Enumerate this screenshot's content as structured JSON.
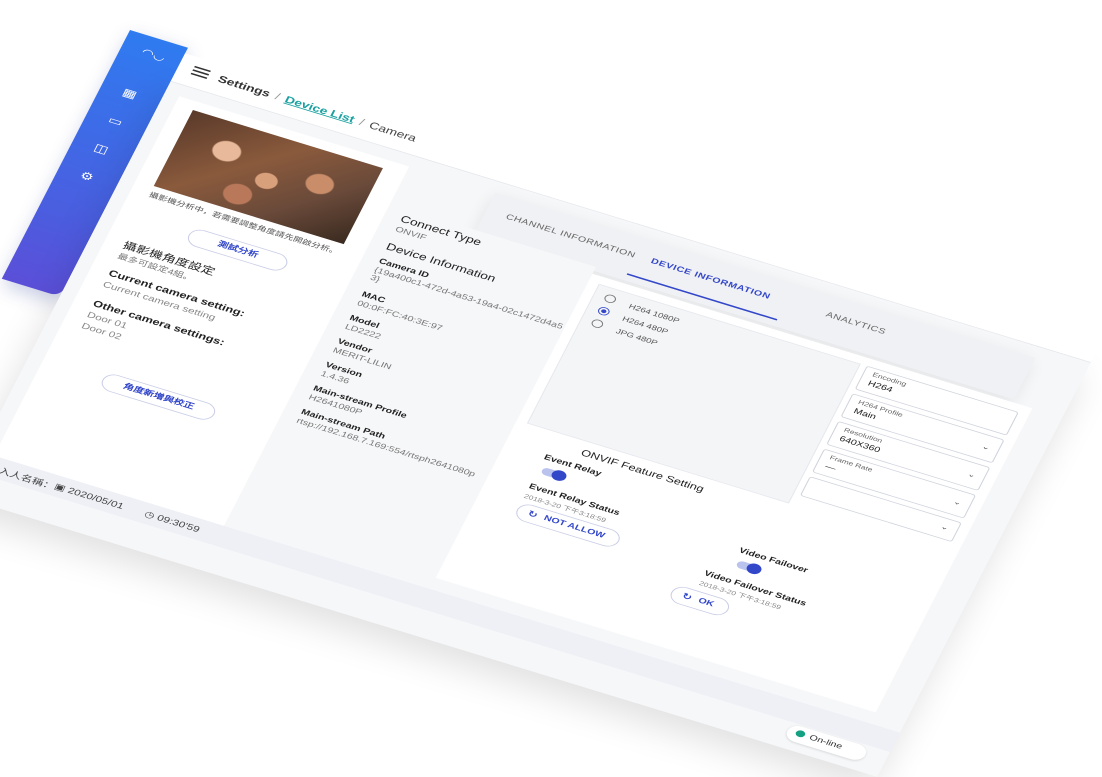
{
  "breadcrumb": {
    "root": "Settings",
    "link": "Device List",
    "current": "Camera"
  },
  "left": {
    "caption": "攝影機分析中，若需要調整角度請先開啟分析。",
    "test_button": "測試分析",
    "angle_title": "攝影機角度設定",
    "angle_sub": "最多可設定4組。",
    "current_label": "Current camera setting:",
    "current_value": "Current camera setting",
    "other_label": "Other camera settings:",
    "doors": [
      "Door 01",
      "Door 02"
    ],
    "calibrate_button": "角度新增與校正"
  },
  "tabs": {
    "channel": "CHANNEL INFORMATION",
    "device": "DEVICE INFORMATION",
    "analytics": "ANALYTICS"
  },
  "device": {
    "connect_type_title": "Connect Type",
    "connect_type_value": "ONVIF",
    "device_info_title": "Device Information",
    "camera_id_label": "Camera ID",
    "camera_id_value": "{19a400c1-472d-4a53-19a4-02c1472d4a53}",
    "mac_label": "MAC",
    "mac_value": "00:0F:FC:40:3E:97",
    "model_label": "Model",
    "model_value": "LD2222",
    "vendor_label": "Vendor",
    "vendor_value": "MERIT-LILIN",
    "version_label": "Version",
    "version_value": "1.4.36",
    "main_profile_label": "Main-stream Profile",
    "main_profile_value": "H2641080P",
    "main_path_label": "Main-stream Path",
    "main_path_value": "rtsp://192.168.7.169:554/rtsph2641080p"
  },
  "resolutions": [
    {
      "label": "H264 1080P",
      "selected": false
    },
    {
      "label": "H264 480P",
      "selected": true
    },
    {
      "label": "JPG 480P",
      "selected": false
    }
  ],
  "fields": {
    "encoding_label": "Encoding",
    "encoding_value": "H264",
    "profile_label": "H264 Profile",
    "profile_value": "Main",
    "resolution_label": "Resolution",
    "resolution_value": "640X360",
    "framerate_label": "Frame Rate",
    "framerate_value": "—"
  },
  "onvif": {
    "title": "ONVIF Feature Setting",
    "event_relay": "Event Relay",
    "event_relay_status": "Event Relay Status",
    "event_relay_time": "2018-3-20 下午3:18:59",
    "not_allow": "NOT ALLOW",
    "video_failover": "Video Failover",
    "video_failover_status": "Video Failover Status",
    "video_failover_time": "2018-3-20 下午3:18:59",
    "ok": "OK"
  },
  "status": {
    "login_label": "登入人名稱：",
    "date": "2020/05/01",
    "time": "09:30'59",
    "online": "On-line"
  },
  "colors": {
    "sidebar": "#2f7bf0",
    "accent": "#3347c9",
    "online": "#13a083",
    "link": "#1aa0a0"
  }
}
